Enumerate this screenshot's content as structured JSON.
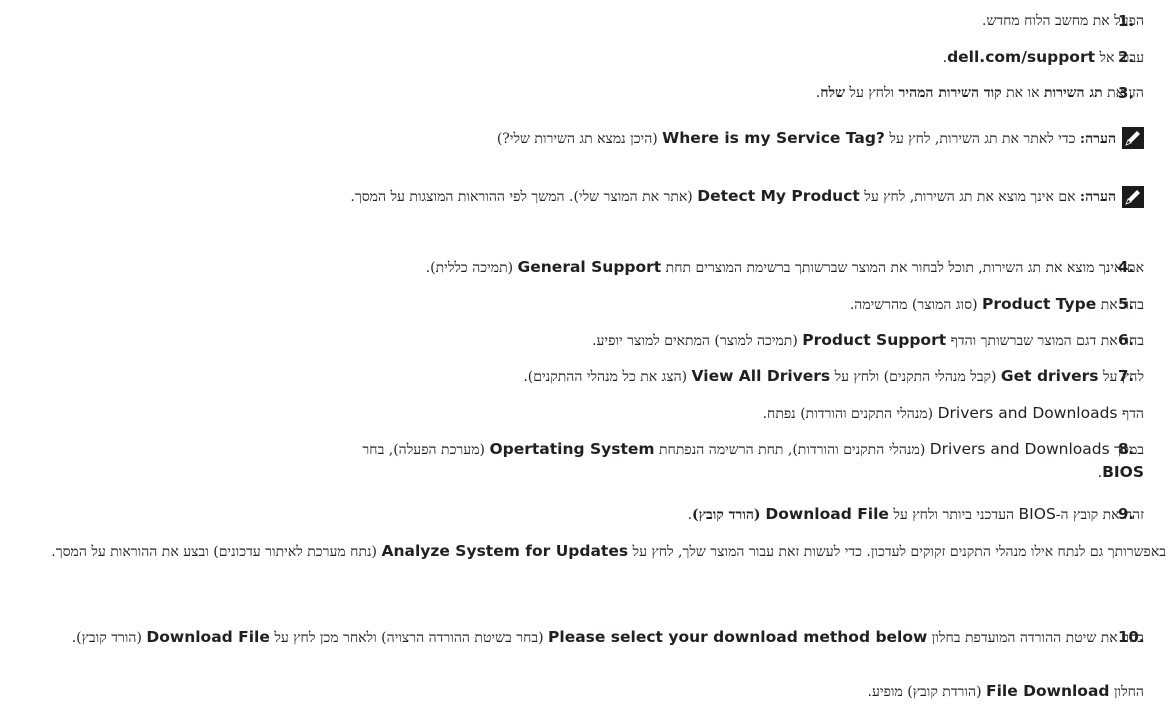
{
  "steps": [
    {
      "num": "1.",
      "text": "הפעל את מחשב הלוח מחדש."
    },
    {
      "num": "2.",
      "pre": "עבור אל ",
      "en": "dell.com/support",
      "post": "."
    },
    {
      "num": "3.",
      "a": "הזן את ",
      "b1": "תג השירות",
      "c": " או את ",
      "b2": "קוד השירות המהיר",
      "d": " ולחץ על ",
      "b3": "שלח",
      "e": "."
    },
    {
      "num": "4.",
      "pre": "אם אינך מוצא את תג השירות, תוכל לבחור את המוצר שברשותך ברשימת המוצרים תחת ",
      "en": "General Support",
      "post": " (תמיכה כללית)."
    },
    {
      "num": "5.",
      "pre": "בחר את ",
      "en": "Product Type",
      "post": " (סוג המוצר) מהרשימה."
    },
    {
      "num": "6.",
      "pre": "בחר את דגם המוצר שברשותך והדף ",
      "en": "Product Support",
      "post": " (תמיכה למוצר) המתאים למוצר יופיע."
    },
    {
      "num": "7.",
      "pre": "לחץ על ",
      "en1": "Get drivers",
      "mid": " (קבל מנהלי התקנים) ולחץ על ",
      "en2": "View All Drivers",
      "post": " (הצג את כל מנהלי ההתקנים)."
    },
    {
      "num": "8.",
      "pre": "במסך ",
      "enl": "Drivers and Downloads",
      "mid": " (מנהלי התקנים והורדות), תחת הרשימה הנפתחת ",
      "en1": "Opertating System",
      "mid2": " (מערכת הפעלה), בחר ",
      "en2": "BIOS",
      "post": "."
    },
    {
      "num": "9.",
      "pre": "זהה את קובץ ה-",
      "enl": "BIOS",
      "mid": " העדכני ביותר ולחץ על ",
      "en": "Download File",
      "b": " (הורד קובץ)",
      "post": "."
    },
    {
      "num": "10.",
      "pre": "בחר את שיטת ההורדה המועדפת בחלון ",
      "en1": "Please select your download method below",
      "mid": " (בחר בשיטת ההורדה הרצויה) ולאחר מכן לחץ על ",
      "en2": "Download File",
      "post": " (הורד קובץ)."
    }
  ],
  "notes": [
    {
      "label": "הערה:",
      "pre": " כדי לאתר את תג השירות, לחץ על ",
      "en": "Where is my Service Tag?",
      "post": " (היכן נמצא תג השירות שלי?)"
    },
    {
      "label": "הערה:",
      "pre": " אם אינך מוצא את תג השירות, לחץ על ",
      "en": "Detect My Product",
      "post": " (אתר את המוצר שלי). המשך לפי ההוראות המוצגות על המסך."
    }
  ],
  "sub7": {
    "pre": "הדף ",
    "enl": "Drivers and Downloads",
    "post": " (מנהלי התקנים והורדות) נפתח."
  },
  "para9": {
    "pre": "באפשרותך גם לנתח אילו מנהלי התקנים זקוקים לעדכון. כדי לעשות זאת עבור המוצר שלך, לחץ על ",
    "en": "Analyze System for Updates",
    "post": " (נתח מערכת לאיתור עדכונים) ובצע את ההוראות על המסך."
  },
  "sub10": {
    "pre": "החלון ",
    "en": "File Download",
    "post": " (הורדת קובץ) מופיע."
  }
}
